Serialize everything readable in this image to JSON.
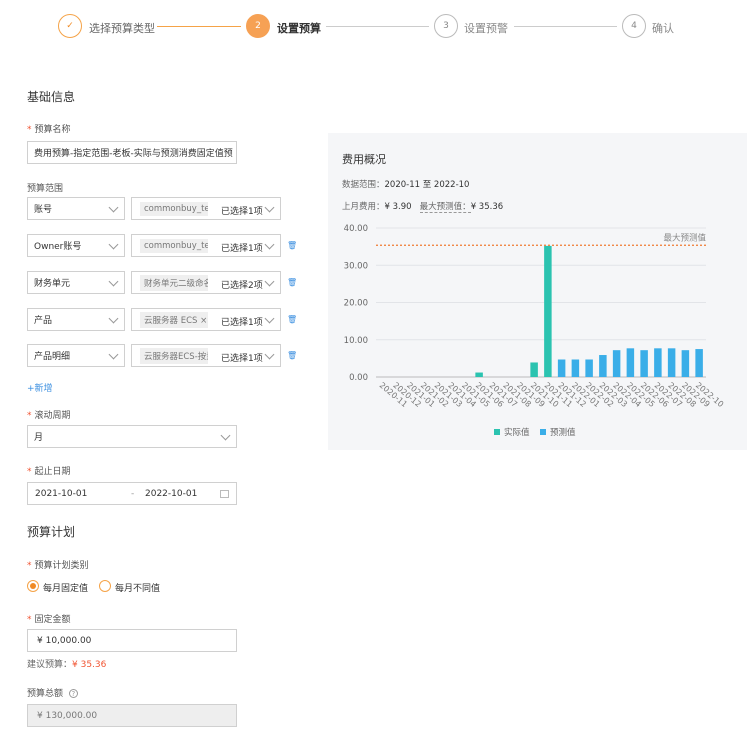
{
  "steps": [
    {
      "label": "选择预算类型",
      "marker": "✓",
      "state": "done"
    },
    {
      "label": "设置预算",
      "marker": "2",
      "state": "active"
    },
    {
      "label": "设置预警",
      "marker": "3",
      "state": "todo"
    },
    {
      "label": "确认",
      "marker": "4",
      "state": "todo"
    }
  ],
  "basic": {
    "title": "基础信息",
    "name_label": "预算名称",
    "name_value": "费用预算-指定范围-老板-实际与预测消费固定值预",
    "scope_label": "预算范围",
    "scope_rows": [
      {
        "dim": "账号",
        "tag": "commonbuy_test",
        "count": "已选择1项",
        "deletable": false
      },
      {
        "dim": "Owner账号",
        "tag": "commonbuy_test",
        "count": "已选择1项",
        "deletable": true
      },
      {
        "dim": "财务单元",
        "tag": "财务单元二级命名",
        "count": "已选择2项",
        "deletable": true
      },
      {
        "dim": "产品",
        "tag": "云服务器 ECS ×",
        "count": "已选择1项",
        "deletable": true
      },
      {
        "dim": "产品明细",
        "tag": "云服务器ECS-按量",
        "count": "已选择1项",
        "deletable": true
      }
    ],
    "add_link": "+新增",
    "cycle_label": "滚动周期",
    "cycle_value": "月",
    "date_label": "起止日期",
    "date_start": "2021-10-01",
    "date_sep": "-",
    "date_end": "2022-10-01"
  },
  "plan": {
    "title": "预算计划",
    "type_label": "预算计划类别",
    "option_fixed": "每月固定值",
    "option_varied": "每月不同值",
    "amount_label": "固定金额",
    "amount_value": "¥  10,000.00",
    "suggest_label": "建议预算：",
    "suggest_value": "¥ 35.36",
    "total_label": "预算总额",
    "total_value": "¥  130,000.00"
  },
  "overview": {
    "title": "费用概况",
    "range_label": "数据范围：",
    "range_value": "2020-11  至  2022-10",
    "last_label": "上月费用：",
    "last_value": "¥ 3.90",
    "max_label": "最大预测值：",
    "max_value": "¥ 35.36"
  },
  "colors": {
    "accent": "#f08a24",
    "actual": "#2bc3b0",
    "forecast": "#3aaee8",
    "max_line": "#f07a30"
  },
  "chart_data": {
    "type": "bar",
    "categories": [
      "2020-11",
      "2020-12",
      "2021-01",
      "2021-02",
      "2021-03",
      "2021-04",
      "2021-05",
      "2021-06",
      "2021-07",
      "2021-08",
      "2021-09",
      "2021-10",
      "2021-11",
      "2021-12",
      "2022-01",
      "2022-02",
      "2022-03",
      "2022-04",
      "2022-05",
      "2022-06",
      "2022-07",
      "2022-08",
      "2022-09",
      "2022-10"
    ],
    "series": [
      {
        "name": "实际值",
        "values": [
          0,
          0,
          0,
          0,
          0,
          0,
          0,
          1.2,
          0,
          0,
          0,
          3.9,
          35.2,
          0,
          0,
          0,
          0,
          0,
          0,
          0,
          0,
          0,
          0,
          0
        ]
      },
      {
        "name": "预测值",
        "values": [
          0,
          0,
          0,
          0,
          0,
          0,
          0,
          0,
          0,
          0,
          0,
          0,
          0,
          4.7,
          4.7,
          4.7,
          5.9,
          7.2,
          7.7,
          7.2,
          7.7,
          7.7,
          7.2,
          7.5
        ]
      }
    ],
    "ylim": [
      0,
      40
    ],
    "yticks": [
      "0.00",
      "10.00",
      "20.00",
      "30.00",
      "40.00"
    ],
    "max_line_value": 35.36,
    "max_line_label": "最大预测值",
    "legend_position": "bottom"
  }
}
